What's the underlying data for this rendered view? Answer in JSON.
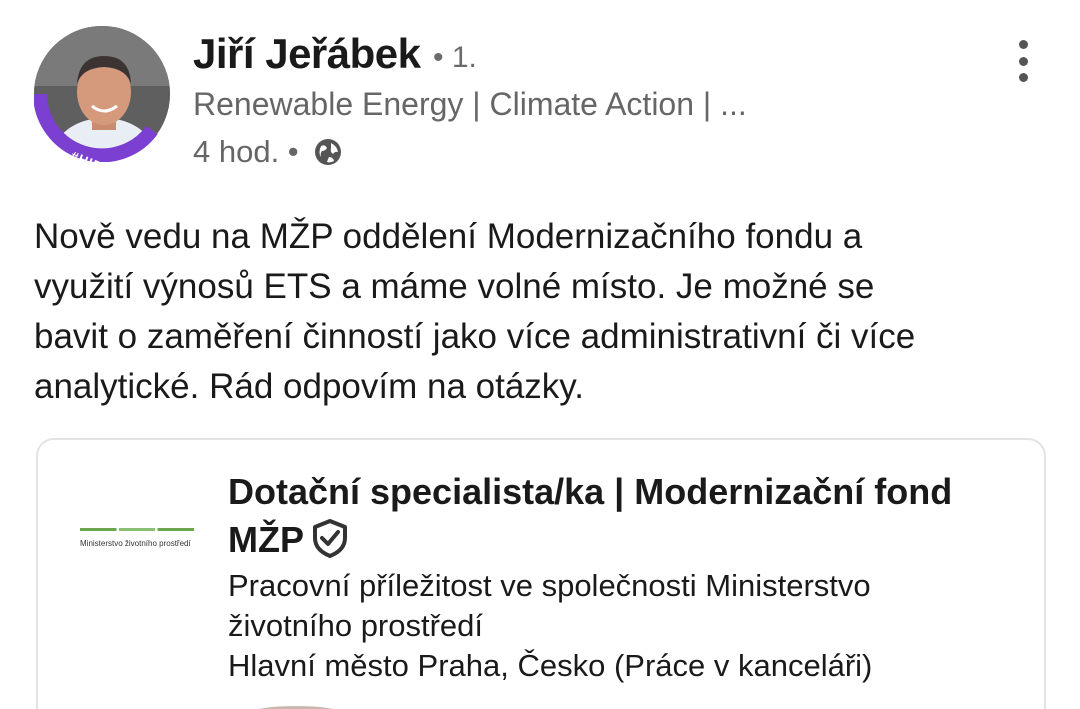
{
  "author": {
    "name": "Jiří Jeřábek",
    "connection": "• 1.",
    "headline": "Renewable Energy | Climate Action | ...",
    "time": "4 hod. •",
    "avatar_badge": "#HIRING",
    "ring_color": "#7b3fd1"
  },
  "post": {
    "lines": [
      "Nově vedu na MŽP oddělení Modernizačního fondu a",
      "využití výnosů ETS a máme volné místo. Je možné se",
      "bavit o zaměření činností jako více administrativní či více",
      "analytické. Rád odpovím na otázky."
    ]
  },
  "job_card": {
    "logo_text": "Ministerstvo životního prostředí",
    "title": "Dotační specialista/ka | Modernizační fond MŽP",
    "company_lines": [
      "Pracovní příležitost ve společnosti Ministerstvo",
      "životního prostředí"
    ],
    "location": "Hlavní město Praha, Česko (Práce v kanceláři)"
  },
  "icons": {
    "more": "more-vertical-icon",
    "visibility": "globe-icon",
    "verified": "verified-shield-icon"
  }
}
